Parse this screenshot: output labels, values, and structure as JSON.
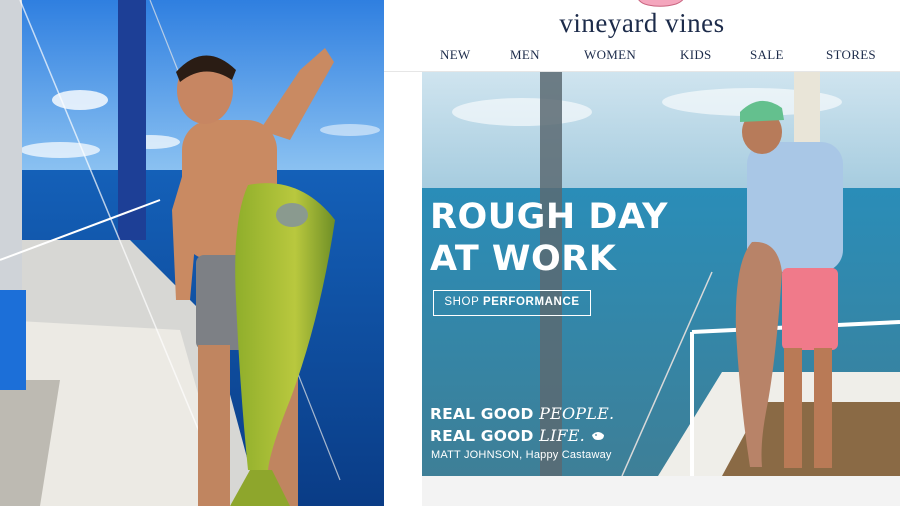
{
  "brand": {
    "name": "vineyard vines",
    "logo_color": "#f4a6bd",
    "text_color": "#1c2b4a"
  },
  "nav": {
    "items": [
      {
        "label": "NEW"
      },
      {
        "label": "MEN"
      },
      {
        "label": "WOMEN"
      },
      {
        "label": "KIDS"
      },
      {
        "label": "SALE"
      },
      {
        "label": "STORES"
      }
    ]
  },
  "hero": {
    "headline_line1": "ROUGH DAY",
    "headline_line2": "AT WORK",
    "cta_prefix": "SHOP ",
    "cta_bold": "PERFORMANCE",
    "tagline_line1_bold": "REAL GOOD ",
    "tagline_line1_script": "PEOPLE.",
    "tagline_line2_bold": "REAL GOOD ",
    "tagline_line2_script": "LIFE.",
    "credit": "MATT JOHNSON, Happy Castaway"
  },
  "left_photo": {
    "icon": "man-holding-mahi-fish-photo"
  }
}
